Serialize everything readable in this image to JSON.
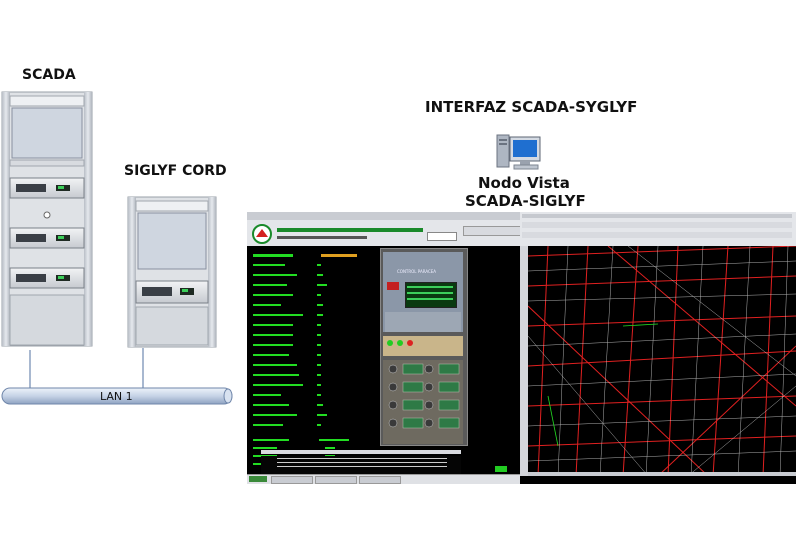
{
  "labels": {
    "scada": "SCADA",
    "siglyf_cord": "SIGLYF CORD",
    "interfaz": "INTERFAZ SCADA-SYGLYF",
    "nodo_line1": "Nodo Vista",
    "nodo_line2": "SCADA-SIGLYF",
    "lan": "LAN 1"
  },
  "scada_screen": {
    "panel_label": "CONTROL PARACEA"
  },
  "colors": {
    "cable": "#8aa0c0",
    "rack_frame": "#c8ccd2",
    "scada_bg": "#000000",
    "scada_green": "#22dd22",
    "gis_bg": "#000000",
    "gis_lines": "#e02020",
    "gis_white": "#dddddd"
  },
  "icons": [
    "computer-icon"
  ]
}
